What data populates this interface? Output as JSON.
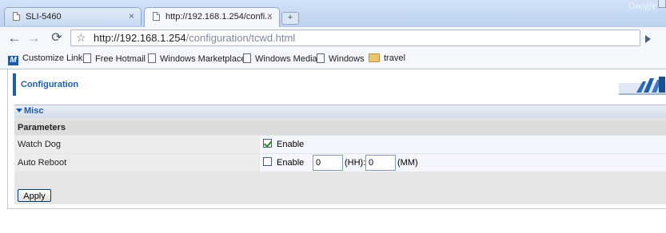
{
  "browser": {
    "brand": "Google",
    "tabs": [
      {
        "title": "SLI-5460",
        "close": "×"
      },
      {
        "title": "http://192.168.1.254/confi...",
        "close": "×"
      }
    ],
    "new_tab": "+",
    "back": "←",
    "forward": "→",
    "reload": "⟳",
    "star": "☆",
    "url_host": "http://192.168.1.254",
    "url_path": "/configuration/tcwd.html",
    "bookmarks": [
      {
        "label": "Customize Links",
        "icon": "msn-icon"
      },
      {
        "label": "Free Hotmail",
        "icon": "page-icon"
      },
      {
        "label": "Windows Marketplace",
        "icon": "page-icon"
      },
      {
        "label": "Windows Media",
        "icon": "page-icon"
      },
      {
        "label": "Windows",
        "icon": "page-icon"
      },
      {
        "label": "travel",
        "icon": "folder-icon"
      }
    ]
  },
  "page": {
    "header_title": "Configuration",
    "section_title": "Misc",
    "parameters_label": "Parameters",
    "watchdog": {
      "label": "Watch Dog",
      "enable_label": "Enable",
      "checked": true
    },
    "auto_reboot": {
      "label": "Auto Reboot",
      "enable_label": "Enable",
      "checked": false,
      "hh_value": "0",
      "hh_unit": "(HH):",
      "mm_value": "0",
      "mm_unit": "(MM)"
    },
    "apply_label": "Apply"
  },
  "colors": {
    "accent": "#1b5faa",
    "panel": "#e5e5e5",
    "chrome": "#f4f7fb"
  }
}
